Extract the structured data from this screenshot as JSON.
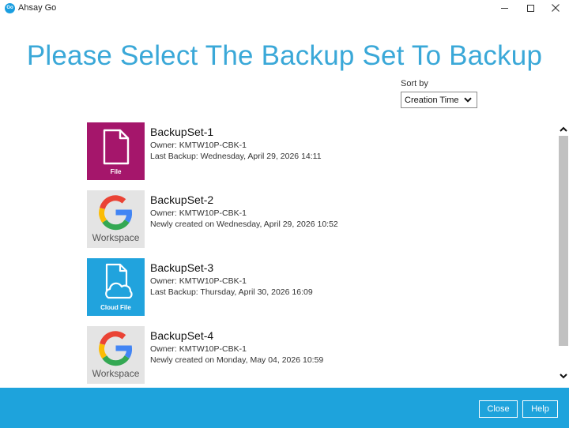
{
  "window": {
    "title": "Ahsay Go",
    "logo_text": "Go"
  },
  "page": {
    "title": "Please Select The Backup Set To Backup"
  },
  "sort": {
    "label": "Sort by",
    "value": "Creation Time"
  },
  "backup_sets": [
    {
      "name": "BackupSet-1",
      "owner": "Owner: KMTW10P-CBK-1",
      "status": "Last Backup: Wednesday, April 29, 2026 14:11",
      "type_caption": "File",
      "icon": "file-icon",
      "tile_color": "#a5166b"
    },
    {
      "name": "BackupSet-2",
      "owner": "Owner: KMTW10P-CBK-1",
      "status": "Newly created on Wednesday, April 29, 2026 10:52",
      "type_caption": "Workspace",
      "icon": "google-workspace-icon",
      "tile_color": "#e4e4e4"
    },
    {
      "name": "BackupSet-3",
      "owner": "Owner: KMTW10P-CBK-1",
      "status": "Last Backup: Thursday, April 30, 2026 16:09",
      "type_caption": "Cloud File",
      "icon": "cloud-file-icon",
      "tile_color": "#21a3dd"
    },
    {
      "name": "BackupSet-4",
      "owner": "Owner: KMTW10P-CBK-1",
      "status": "Newly created on Monday, May 04, 2026 10:59",
      "type_caption": "Workspace",
      "icon": "google-workspace-icon",
      "tile_color": "#e4e4e4"
    }
  ],
  "footer": {
    "close_label": "Close",
    "help_label": "Help",
    "background": "#1ea3dc"
  },
  "colors": {
    "title": "#3aa8d8"
  }
}
